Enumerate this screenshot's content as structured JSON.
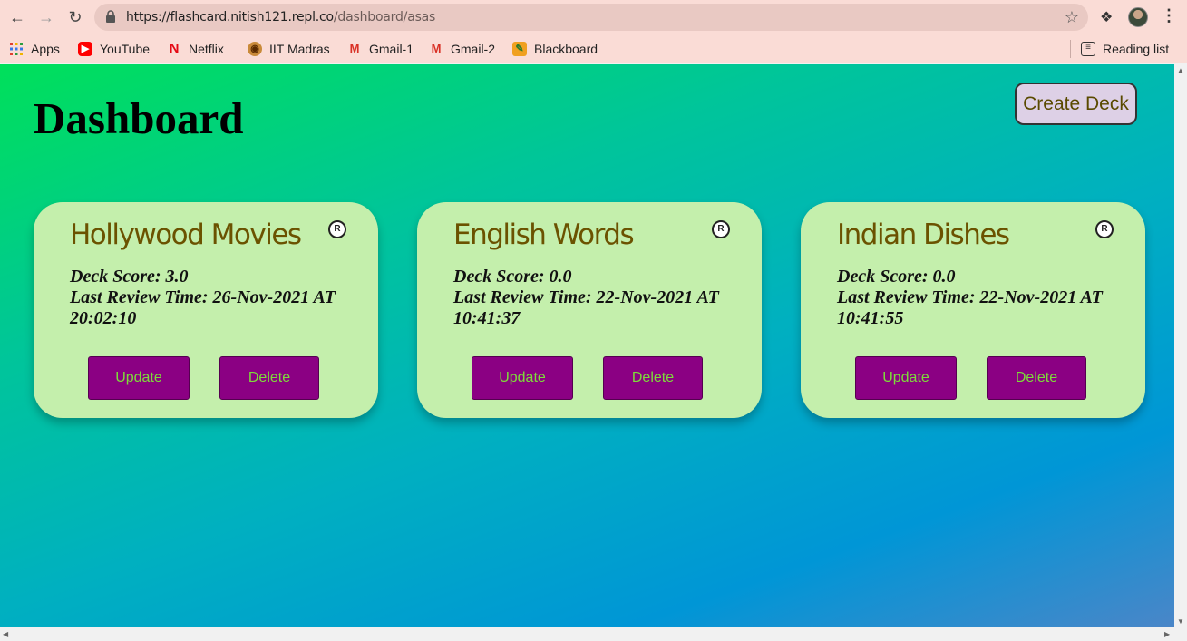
{
  "browser": {
    "url_host": "https://flashcard.nitish121.repl.co",
    "url_path": "/dashboard/asas",
    "bookmarks": [
      {
        "label": "Apps",
        "icon": "apps-grid-icon"
      },
      {
        "label": "YouTube",
        "icon": "youtube-icon"
      },
      {
        "label": "Netflix",
        "icon": "netflix-icon"
      },
      {
        "label": "IIT Madras",
        "icon": "iit-madras-icon"
      },
      {
        "label": "Gmail-1",
        "icon": "gmail-icon"
      },
      {
        "label": "Gmail-2",
        "icon": "gmail-icon"
      },
      {
        "label": "Blackboard",
        "icon": "blackboard-icon"
      }
    ],
    "reading_list": "Reading list"
  },
  "page": {
    "title": "Dashboard",
    "create_deck_label": "Create Deck",
    "decks": [
      {
        "title": "Hollywood Movies",
        "badge": "R",
        "score_line": "Deck Score: 3.0",
        "review_line": "Last Review Time: 26-Nov-2021 AT 20:02:10",
        "update_label": "Update",
        "delete_label": "Delete"
      },
      {
        "title": "English Words",
        "badge": "R",
        "score_line": "Deck Score: 0.0",
        "review_line": "Last Review Time: 22-Nov-2021 AT 10:41:37",
        "update_label": "Update",
        "delete_label": "Delete"
      },
      {
        "title": "Indian Dishes",
        "badge": "R",
        "score_line": "Deck Score: 0.0",
        "review_line": "Last Review Time: 22-Nov-2021 AT 10:41:55",
        "update_label": "Update",
        "delete_label": "Delete"
      }
    ]
  },
  "colors": {
    "card_bg": "#c4efac",
    "card_title": "#6b5200",
    "button_bg": "#8b0083",
    "button_text": "#7ddc3a",
    "create_btn_bg": "#ddd0e6"
  }
}
